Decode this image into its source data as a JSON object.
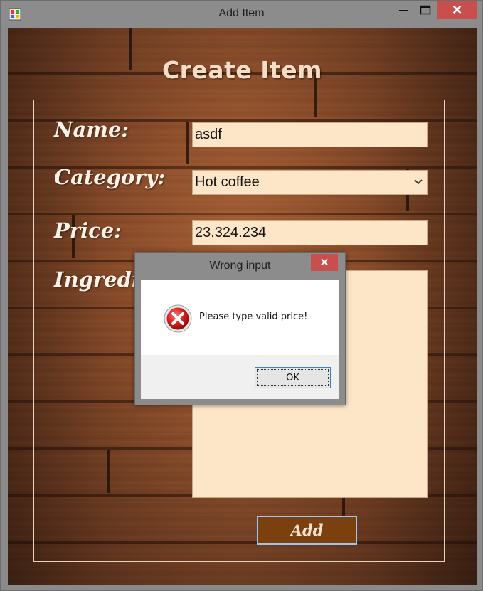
{
  "window": {
    "title": "Add Item",
    "minimize_glyph": "—",
    "maximize_glyph": "☐",
    "close_glyph": "✕"
  },
  "form": {
    "heading": "Create Item",
    "name_label": "Name:",
    "name_value": "asdf",
    "category_label": "Category:",
    "category_value": "Hot coffee",
    "price_label": "Price:",
    "price_value": "23.324.234",
    "ingredients_label": "Ingredients:",
    "ingredients_value": "",
    "add_label": "Add"
  },
  "dialog": {
    "title": "Wrong input",
    "close_glyph": "✕",
    "message": "Please type valid price!",
    "ok_label": "OK",
    "icon": "error-icon"
  },
  "colors": {
    "input_background": "#fde5c8",
    "add_button": "#7c400f",
    "close_button": "#c94f4f"
  }
}
